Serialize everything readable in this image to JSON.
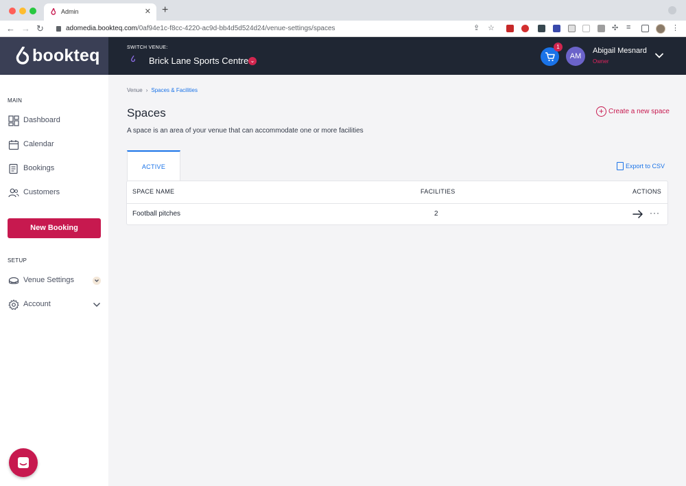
{
  "browser": {
    "tab_title": "Admin",
    "tab_close": "✕",
    "new_tab": "+",
    "url_host": "adomedia.bookteq.com",
    "url_path": "/0af94e1c-f8cc-4220-ac9d-bb4d5d524d24/venue-settings/spaces",
    "back": "←",
    "forward": "→",
    "reload": "↻"
  },
  "header": {
    "logo_text": "bookteq",
    "switch_label": "SWITCH VENUE:",
    "venue_name": "Brick Lane Sports Centre",
    "venue_chevron": "⌄",
    "cart_count": "1",
    "avatar_initials": "AM",
    "user_name": "Abigail Mesnard",
    "user_role": "Owner"
  },
  "sidebar": {
    "main_title": "MAIN",
    "main_items": [
      {
        "label": "Dashboard",
        "icon": "dashboard-icon"
      },
      {
        "label": "Calendar",
        "icon": "calendar-icon"
      },
      {
        "label": "Bookings",
        "icon": "bookings-icon"
      },
      {
        "label": "Customers",
        "icon": "customers-icon"
      }
    ],
    "new_booking": "New Booking",
    "setup_title": "SETUP",
    "setup_items": [
      {
        "label": "Venue Settings",
        "icon": "stadium-icon"
      },
      {
        "label": "Account",
        "icon": "gear-icon"
      }
    ]
  },
  "main": {
    "breadcrumb": {
      "root": "Venue",
      "sep": "›",
      "current": "Spaces & Facilities"
    },
    "title": "Spaces",
    "description": "A space is an area of your venue that can accommodate one or more facilities",
    "create_label": "Create a new space",
    "create_plus": "+",
    "tab_active": "ACTIVE",
    "export_label": "Export to CSV",
    "table": {
      "headers": {
        "name": "SPACE NAME",
        "facilities": "FACILITIES",
        "actions": "ACTIONS"
      },
      "rows": [
        {
          "name": "Football pitches",
          "facilities": "2",
          "more": "···"
        }
      ]
    }
  },
  "colors": {
    "brand": "#c7194f",
    "header_bg": "#1f2633",
    "link": "#1a73e8"
  }
}
